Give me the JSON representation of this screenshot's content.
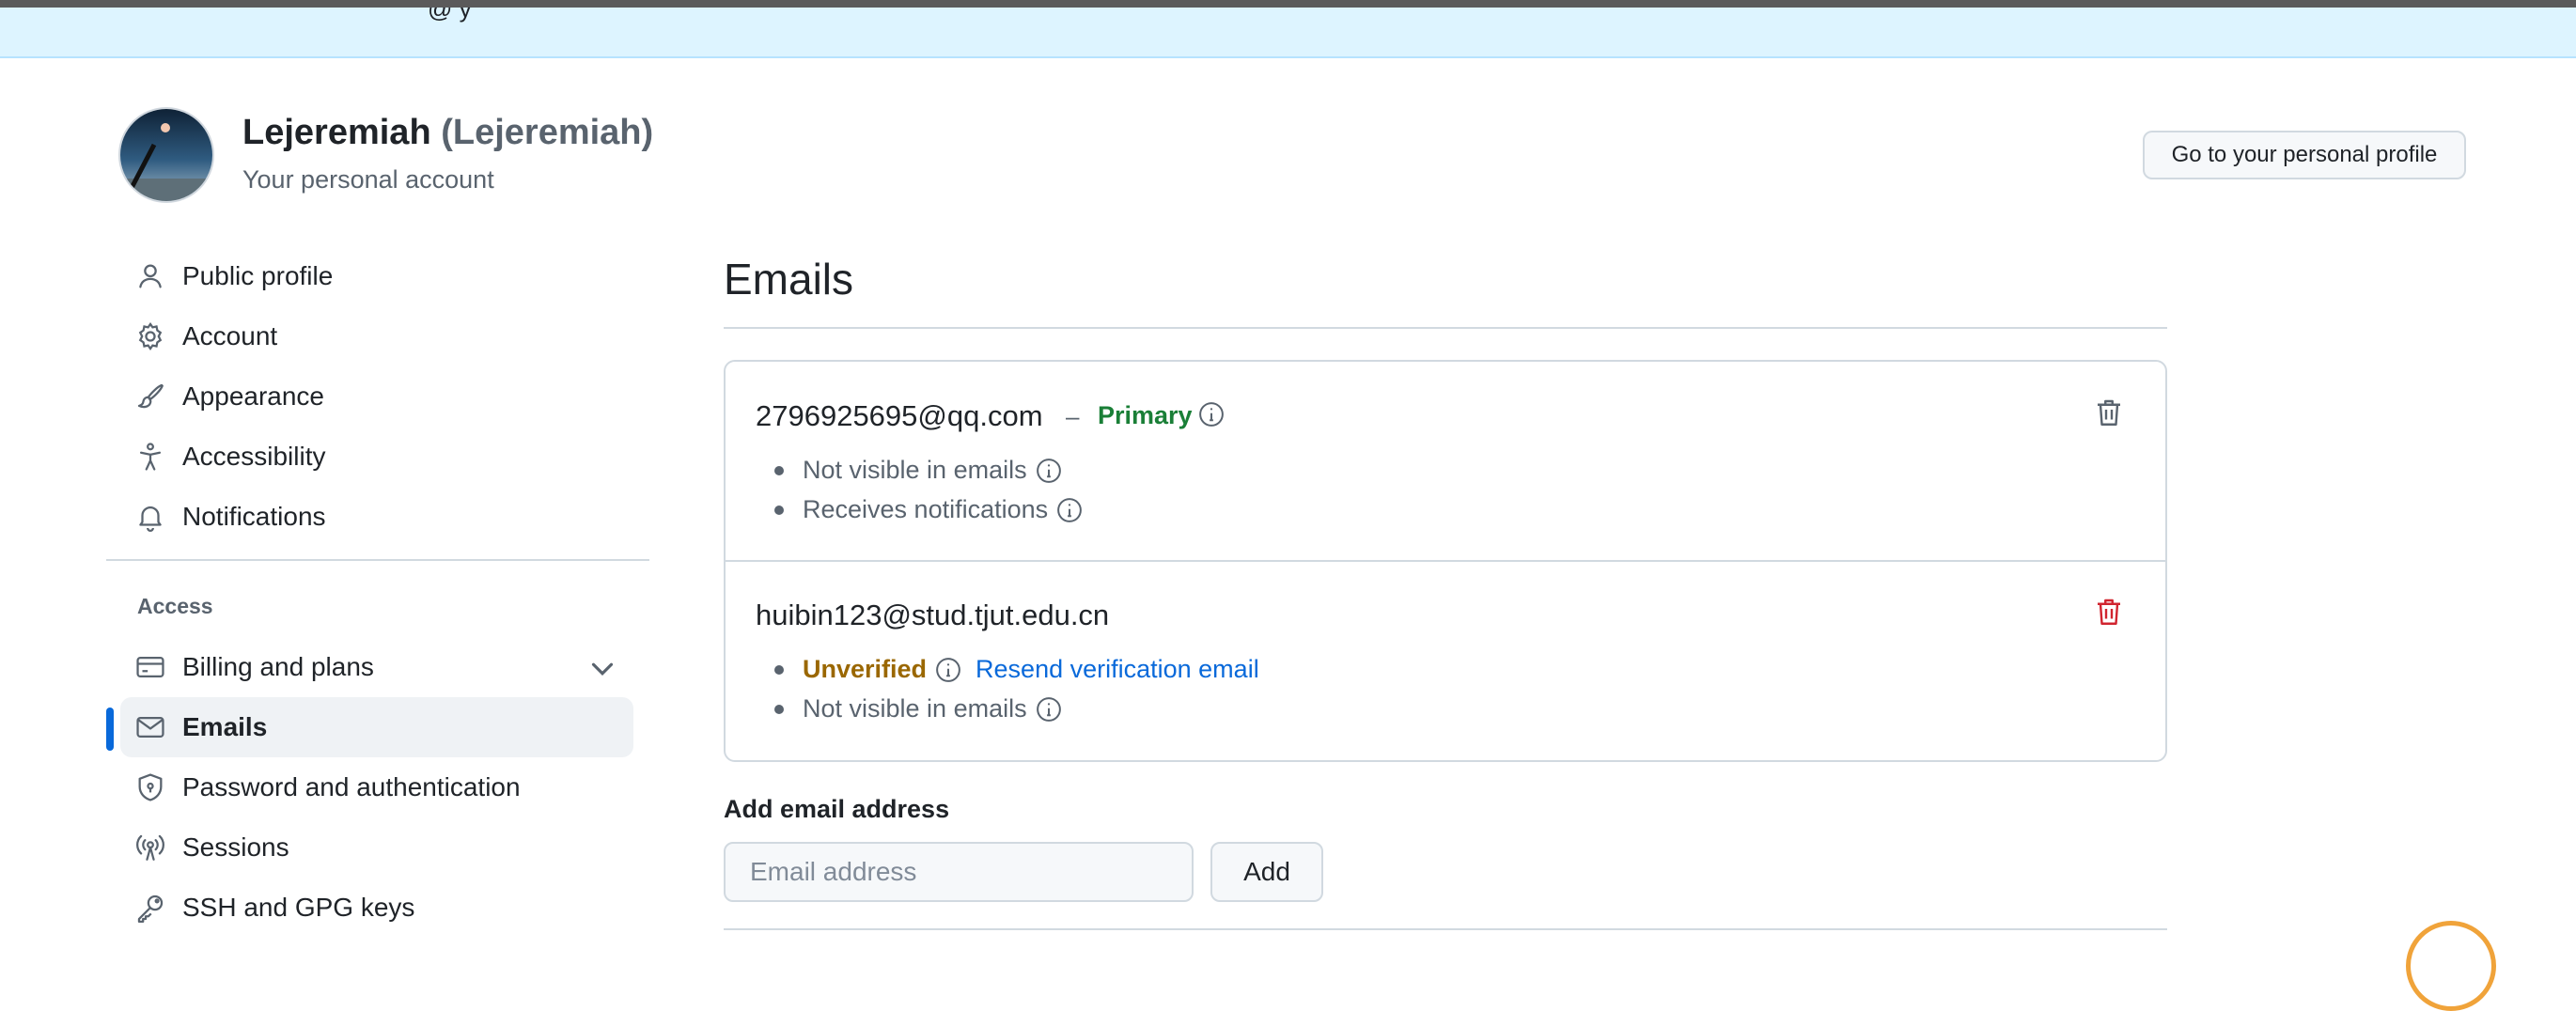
{
  "banner": {
    "text": "@ y"
  },
  "account": {
    "name": "Lejeremiah",
    "login": "(Lejeremiah)",
    "subtitle": "Your personal account",
    "profile_button": "Go to your personal profile"
  },
  "sidebar": {
    "items": [
      {
        "label": "Public profile",
        "icon": "person-icon"
      },
      {
        "label": "Account",
        "icon": "gear-icon"
      },
      {
        "label": "Appearance",
        "icon": "paintbrush-icon"
      },
      {
        "label": "Accessibility",
        "icon": "accessibility-icon"
      },
      {
        "label": "Notifications",
        "icon": "bell-icon"
      }
    ],
    "access_title": "Access",
    "access_items": [
      {
        "label": "Billing and plans",
        "icon": "credit-card-icon",
        "expandable": true
      },
      {
        "label": "Emails",
        "icon": "mail-icon",
        "selected": true
      },
      {
        "label": "Password and authentication",
        "icon": "shield-lock-icon"
      },
      {
        "label": "Sessions",
        "icon": "broadcast-icon"
      },
      {
        "label": "SSH and GPG keys",
        "icon": "key-icon"
      }
    ]
  },
  "main": {
    "title": "Emails",
    "emails": [
      {
        "address": "2796925695@qq.com",
        "separator": "–",
        "badge": "Primary",
        "details": [
          "Not visible in emails",
          "Receives notifications"
        ]
      },
      {
        "address": "huibin123@stud.tjut.edu.cn",
        "status": "Unverified",
        "resend_link": "Resend verification email",
        "details": [
          "Not visible in emails"
        ]
      }
    ],
    "add_email": {
      "label": "Add email address",
      "placeholder": "Email address",
      "button": "Add"
    }
  },
  "colors": {
    "accent": "#0969da",
    "primary_badge": "#1a7f37",
    "unverified": "#9a6700",
    "danger": "#d1242f",
    "banner_bg": "#ddf4ff"
  }
}
